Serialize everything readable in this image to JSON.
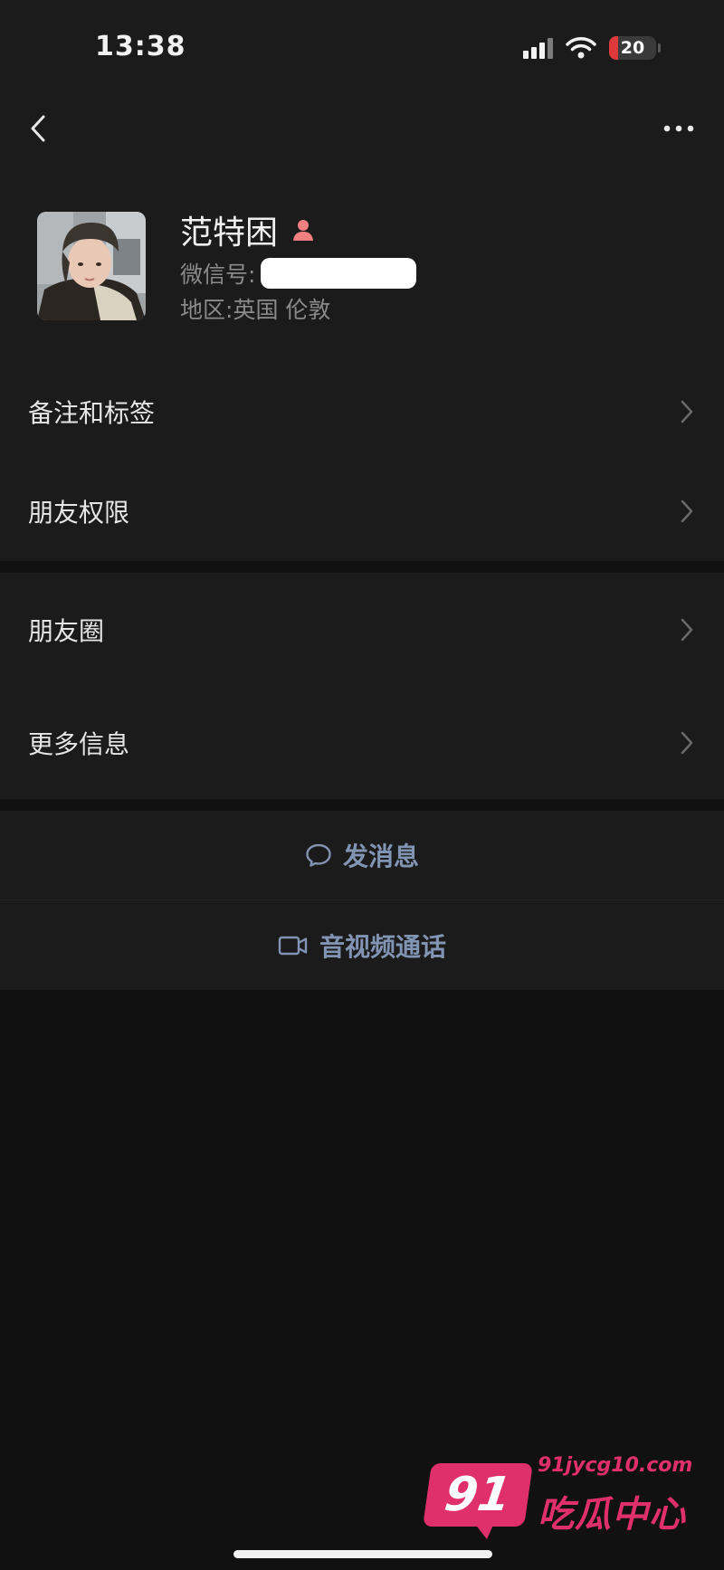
{
  "status_bar": {
    "time": "13:38",
    "battery_level": "20",
    "battery_fraction": 0.2,
    "battery_color": "#e0393b",
    "icons": [
      "cellular-signal-icon",
      "wifi-icon",
      "battery-icon"
    ]
  },
  "navigation": {
    "back_icon": "chevron-left-icon",
    "more_icon": "more-dots-icon"
  },
  "profile": {
    "name": "范特困",
    "gender_icon": "female-person-icon",
    "gender_color": "#f08080",
    "wechat_id_label": "微信号:",
    "region_label": "地区:",
    "region_value": "英国 伦敦"
  },
  "menu": {
    "remarks_tags": "备注和标签",
    "friend_permissions": "朋友权限",
    "moments": "朋友圈",
    "more_info": "更多信息"
  },
  "actions": {
    "send_message": "发消息",
    "av_call": "音视频通话",
    "accent_color": "#8194b3"
  },
  "watermark": {
    "number": "91",
    "url": "91jycg10.com",
    "title": "吃瓜中心",
    "color": "#e0306b"
  }
}
